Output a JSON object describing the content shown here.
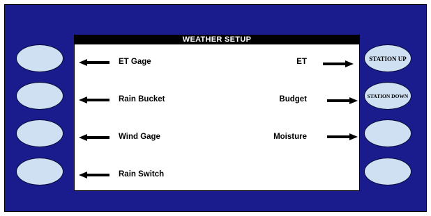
{
  "screen": {
    "title": "WEATHER SETUP"
  },
  "left_options": [
    {
      "label": "ET Gage"
    },
    {
      "label": "Rain Bucket"
    },
    {
      "label": "Wind Gage"
    },
    {
      "label": "Rain Switch"
    }
  ],
  "right_options": [
    {
      "label": "ET"
    },
    {
      "label": "Budget"
    },
    {
      "label": "Moisture"
    }
  ],
  "right_buttons": [
    {
      "label": "STATION UP"
    },
    {
      "label": "STATION DOWN"
    },
    {
      "label": ""
    },
    {
      "label": ""
    }
  ],
  "colors": {
    "panel": "#1a1c8e",
    "button": "#cfe0f3",
    "screen": "#ffffff",
    "title_bar": "#000000"
  },
  "icons": {
    "left_arrow": "arrow-left-icon",
    "right_arrow": "arrow-right-icon"
  }
}
